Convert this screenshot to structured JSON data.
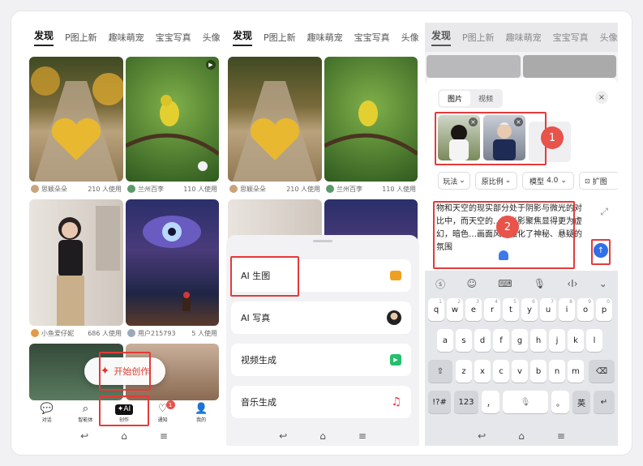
{
  "feed_tabs": [
    "发现",
    "P图上新",
    "趣味萌宠",
    "宝宝写真",
    "头像"
  ],
  "cards": [
    {
      "user": "思颖朵朵",
      "uses": "210 人使用"
    },
    {
      "user": "兰州百李",
      "uses": "110 人使用"
    },
    {
      "user": "小鱼爱仔妮",
      "uses": "686 人使用"
    },
    {
      "user": "用户215793",
      "uses": "5 人使用"
    }
  ],
  "fab_label": "开始创作",
  "bottom_nav": [
    {
      "label": "对话",
      "icon": "chat-icon"
    },
    {
      "label": "智能体",
      "icon": "search-icon"
    },
    {
      "label": "创作",
      "icon": "create-ai-icon"
    },
    {
      "label": "通知",
      "icon": "heart-icon",
      "badge": "1"
    },
    {
      "label": "我的",
      "icon": "profile-icon"
    }
  ],
  "sheet_options": [
    {
      "label": "AI 生图",
      "icon": "image-icon",
      "color": "#f0a020"
    },
    {
      "label": "AI 写真",
      "icon": "portrait-icon",
      "color": "#444444"
    },
    {
      "label": "视频生成",
      "icon": "play-icon",
      "color": "#22c06a"
    },
    {
      "label": "音乐生成",
      "icon": "music-icon",
      "color": "#e8344a"
    }
  ],
  "panel": {
    "mode_tabs": [
      "图片",
      "视频"
    ],
    "chips": {
      "style": "玩法",
      "ratio": "原比例",
      "model_label": "模型",
      "model_value": "4.0",
      "expand": "扩图"
    },
    "prompt": "物和天空的现实部分处于阴影与微光的对比中，而天空的…因光影聚焦显得更为虚幻，暗色…画面风格强化了神秘、悬疑的氛围"
  },
  "annotations": [
    "1",
    "2",
    "3"
  ],
  "keyboard": {
    "numbers": [
      "1",
      "2",
      "3",
      "4",
      "5",
      "6",
      "7",
      "8",
      "9",
      "0"
    ],
    "row1": [
      "q",
      "w",
      "e",
      "r",
      "t",
      "y",
      "u",
      "i",
      "o",
      "p"
    ],
    "row2": [
      "a",
      "s",
      "d",
      "f",
      "g",
      "h",
      "j",
      "k",
      "l"
    ],
    "row3": [
      "z",
      "x",
      "c",
      "v",
      "b",
      "n",
      "m"
    ],
    "symbols": "!?#",
    "num_key": "123",
    "comma": "，",
    "period": "。",
    "lang": "英"
  },
  "colors": {
    "accent_red": "#e53a3a",
    "fab_text": "#e0362a",
    "send_blue": "#2f6fe8"
  }
}
